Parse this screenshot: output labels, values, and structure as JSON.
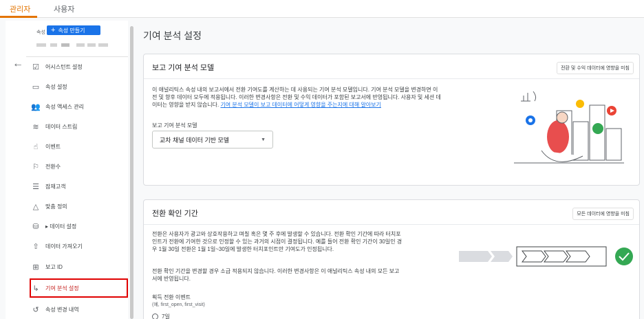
{
  "top_tabs": [
    {
      "label": "관리자",
      "active": true
    },
    {
      "label": "사용자",
      "active": false
    }
  ],
  "property": {
    "label": "속성",
    "create_button": "속성 만들기"
  },
  "nav": [
    {
      "label": "어시스턴트 설정",
      "icon": "checkbox-icon"
    },
    {
      "label": "속성 설정",
      "icon": "property-settings-icon"
    },
    {
      "label": "속성 액세스 관리",
      "icon": "people-icon"
    },
    {
      "label": "데이터 스트림",
      "icon": "data-stream-icon"
    },
    {
      "label": "이벤트",
      "icon": "touch-icon"
    },
    {
      "label": "전환수",
      "icon": "flag-icon"
    },
    {
      "label": "잠재고객",
      "icon": "audience-icon"
    },
    {
      "label": "맞춤 정의",
      "icon": "custom-definitions-icon"
    },
    {
      "label": "▸ 데이터 설정",
      "icon": "database-icon"
    },
    {
      "label": "데이터 가져오기",
      "icon": "upload-icon"
    },
    {
      "label": "보고 ID",
      "icon": "reporting-id-icon"
    },
    {
      "label": "기여 분석 설정",
      "icon": "attribution-icon",
      "active": true
    },
    {
      "label": "속성 변경 내역",
      "icon": "history-icon"
    }
  ],
  "page_title": "기여 분석 설정",
  "card1": {
    "title": "보고 기여 분석 모델",
    "chip": "전환 및 수익 데이터에 영향을 미침",
    "desc_line1": "이 애널리틱스 속성 내의 보고서에서 전환 기여도를 계산하는 데 사용되는 기여 분석 모델입니다. 기여 분석 모델을 변경하면 이",
    "desc_line2": "전 및 향후 데이터 모두에 적용됩니다. 이러한 변경사항은 전환 및 수익 데이터가 포함된 보고서에 반영됩니다. 사용자 및 세션 데",
    "desc_line3_prefix": "이터는 영향을 받지 않습니다. ",
    "desc_link": "기여 분석 모델이 보고 데이터에 어떻게 영향을 주는지에 대해 알아보기",
    "select_label": "보고 기여 분석 모델",
    "select_value": "교차 채널 데이터 기반 모델"
  },
  "card2": {
    "title": "전환 확인 기간",
    "chip": "모든 데이터에 영향을 미침",
    "desc1_line1": "전환은 사용자가 광고와 상호작용하고 며칠 혹은 몇 주 후에 발생할 수 있습니다. 전환 확인 기간에 따라 터치포",
    "desc1_line2": "인트가 전환에 기여한 것으로 인정할 수 있는 과거의 시점이 결정됩니다. 예를 들어 전환 확인 기간이 30일인 경",
    "desc1_line3": "우 1월 30일 전환은 1월 1일~30일에 발생한 터치포인트만 기여도가 인정됩니다.",
    "desc2_line1": "전환 확인 기간을 변경할 경우 소급 적용되지 않습니다. 이러한 변경사항은 이 애널리틱스 속성 내의 모든 보고",
    "desc2_line2": "서에 반영됩니다.",
    "event_label": "획득 전환 이벤트",
    "event_sub": "(예, first_open, first_visit)",
    "radio_option": "7일"
  },
  "colors": {
    "accent": "#e37400",
    "primary": "#1a73e8",
    "highlight": "#e00000",
    "success": "#34a853"
  }
}
